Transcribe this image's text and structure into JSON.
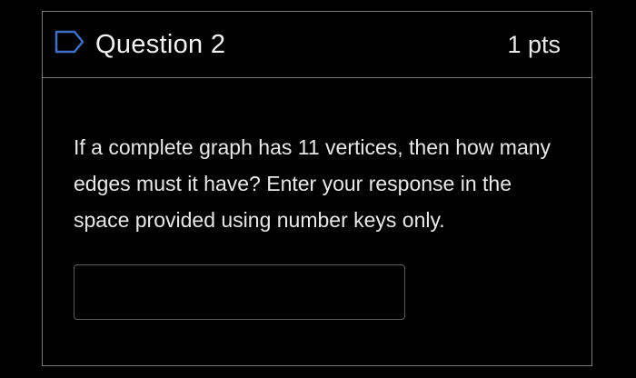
{
  "question": {
    "title": "Question 2",
    "points": "1 pts",
    "flag_icon": "bookmark-flag-icon",
    "prompt": "If a complete graph has 11 vertices, then how many edges must it have? Enter your response in the space provided using number keys only.",
    "answer_value": "",
    "answer_placeholder": ""
  },
  "colors": {
    "background": "#000000",
    "border": "#7a7a7a",
    "flag_icon": "#3f6fc6",
    "text": "#e8e8e8"
  }
}
